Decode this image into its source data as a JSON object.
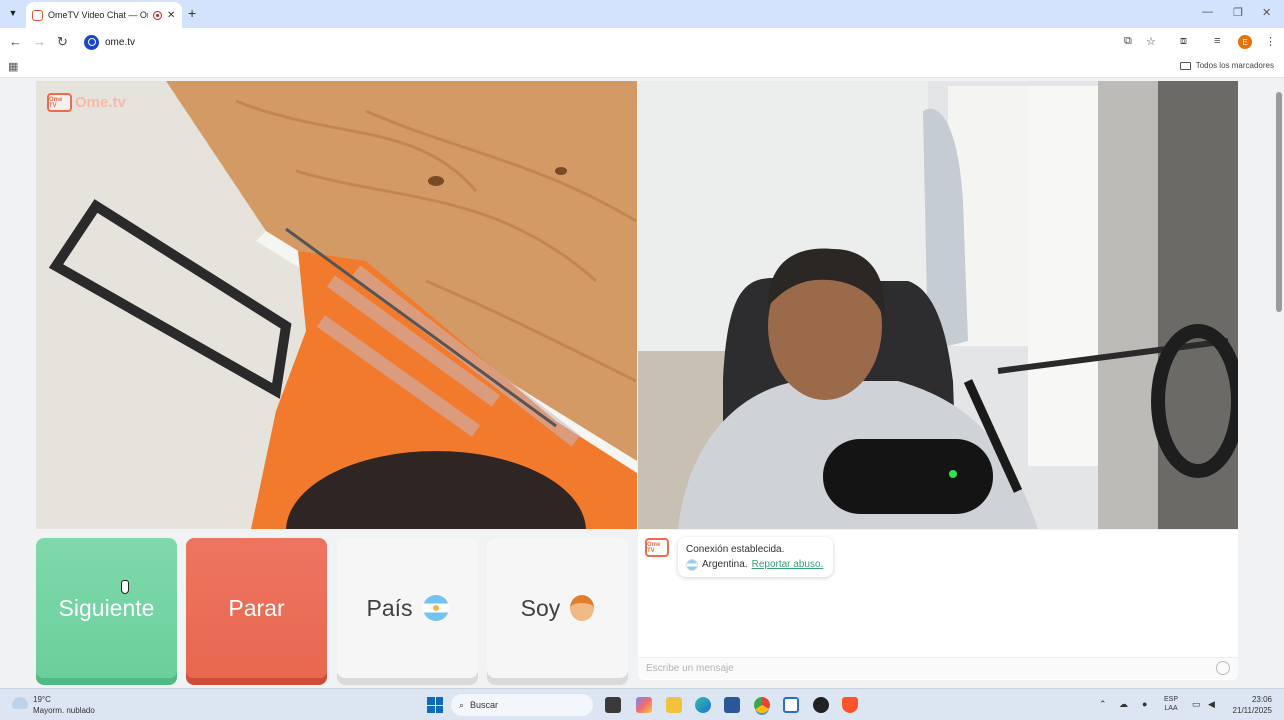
{
  "browser": {
    "tab_title": "OmeTV Video Chat — Ome",
    "url": "ome.tv",
    "bookmarks_all": "Todos los marcadores",
    "profile_initial": "E"
  },
  "page": {
    "brand_name": "Ome.tv",
    "brand_logo_text": "Ome TV",
    "buttons": {
      "next": "Siguiente",
      "stop": "Parar",
      "country": "País",
      "me": "Soy"
    },
    "chat": {
      "status": "Conexión establecida.",
      "country": "Argentina.",
      "report": "Reportar abuso.",
      "placeholder": "Escribe un mensaje"
    }
  },
  "taskbar": {
    "temperature": "19°C",
    "weather": "Mayorm. nublado",
    "search": "Buscar",
    "lang_1": "ESP",
    "lang_2": "LAA",
    "time": "23:06",
    "date": "21/11/2025"
  },
  "colors": {
    "next_button": "#6bcf9c",
    "stop_button": "#e8674f",
    "accent_link": "#3b9e76",
    "brand": "#f06a4d"
  }
}
